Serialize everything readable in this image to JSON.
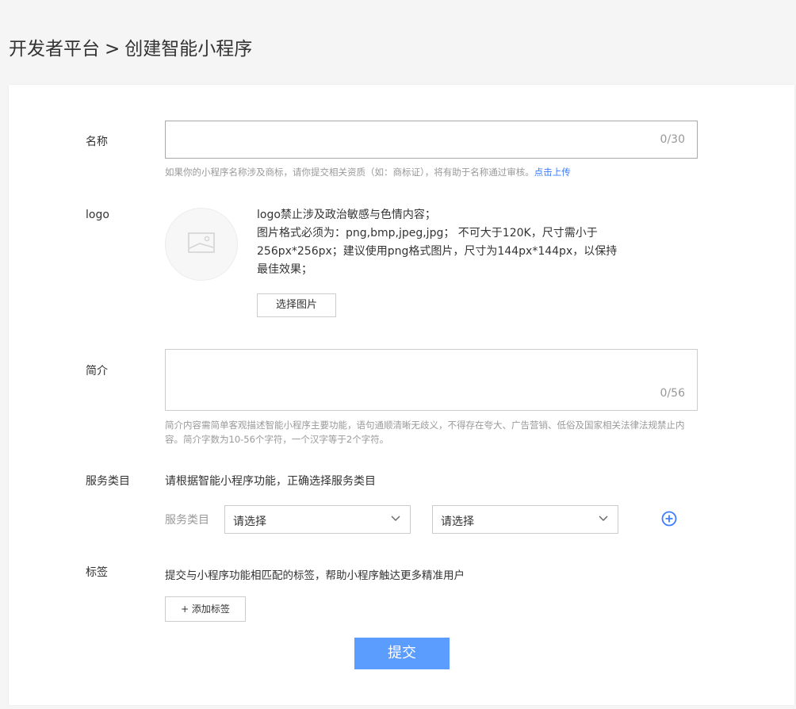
{
  "breadcrumb": {
    "root": "开发者平台",
    "separator": ">",
    "current": "创建智能小程序"
  },
  "form": {
    "name": {
      "label": "名称",
      "value": "",
      "counter": "0/30",
      "hint": "如果你的小程序名称涉及商标，请你提交相关资质（如：商标证），将有助于名称通过审核。",
      "hint_link": "点击上传"
    },
    "logo": {
      "label": "logo",
      "rules": [
        "logo禁止涉及政治敏感与色情内容；",
        "图片格式必须为：png,bmp,jpeg,jpg； 不可大于120K，尺寸需小于256px*256px；建议使用png格式图片，尺寸为144px*144px，以保持最佳效果；"
      ],
      "button": "选择图片",
      "placeholder_icon": "image-placeholder-icon"
    },
    "intro": {
      "label": "简介",
      "value": "",
      "counter": "0/56",
      "hint": "简介内容需简单客观描述智能小程序主要功能，语句通顺清晰无歧义，不得存在夸大、广告营销、低俗及国家相关法律法规禁止内容。简介字数为10-56个字符，一个汉字等于2个字符。"
    },
    "service": {
      "label": "服务类目",
      "description": "请根据智能小程序功能，正确选择服务类目",
      "sub_label": "服务类目",
      "select1": "请选择",
      "select2": "请选择",
      "add_icon": "plus-circle-icon"
    },
    "tags": {
      "label": "标签",
      "description": "提交与小程序功能相匹配的标签，帮助小程序触达更多精准用户",
      "add_button": "+ 添加标签"
    },
    "submit": "提交"
  },
  "colors": {
    "accent": "#5b9cff",
    "link": "#3c7cff",
    "background": "#f5f5f5"
  }
}
